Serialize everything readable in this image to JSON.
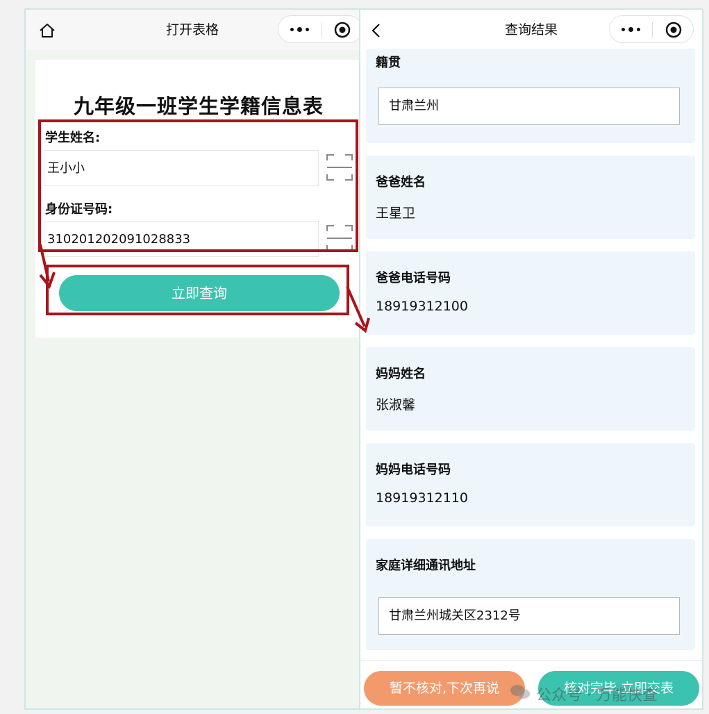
{
  "left_screen": {
    "nav_title": "打开表格",
    "form_title": "九年级一班学生学籍信息表",
    "name_label": "学生姓名:",
    "name_value": "王小小",
    "id_label": "身份证号码:",
    "id_value": "310201202091028833",
    "query_button": "立即查询"
  },
  "right_screen": {
    "nav_title": "查询结果",
    "sections": [
      {
        "label": "籍贯",
        "value": "甘肃兰州",
        "kind": "input"
      },
      {
        "label": "爸爸姓名",
        "value": "王星卫",
        "kind": "text"
      },
      {
        "label": "爸爸电话号码",
        "value": "18919312100",
        "kind": "text"
      },
      {
        "label": "妈妈姓名",
        "value": "张淑馨",
        "kind": "text"
      },
      {
        "label": "妈妈电话号码",
        "value": "18919312110",
        "kind": "text"
      },
      {
        "label": "家庭详细通讯地址",
        "value": "甘肃兰州城关区2312号",
        "kind": "input"
      }
    ],
    "later_button": "暂不核对,下次再说",
    "submit_button": "核对完毕,立即交表"
  },
  "watermark": "公众号 · 万能快查",
  "icons": {
    "home": "home-icon",
    "back": "back-chevron-icon",
    "more": "more-dots-icon",
    "close": "target-circle-icon",
    "scan": "scan-icon",
    "wechat": "wechat-icon"
  },
  "colors": {
    "accent": "#3bc3b0",
    "secondary": "#f39a6c",
    "annotation": "#a8141a",
    "section_bg": "#eef6fb"
  }
}
